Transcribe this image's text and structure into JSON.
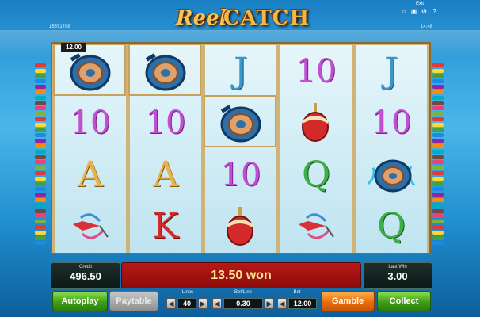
{
  "header": {
    "logo_word1": "Reel",
    "logo_word2": "CATCH",
    "session_id": "15571786",
    "exit_label": "Exit",
    "clock": "14:48"
  },
  "header_icons": [
    "music-icon",
    "fullscreen-icon",
    "settings-icon",
    "help-icon"
  ],
  "reels": [
    [
      "reel-symbol",
      "10",
      "A",
      "lure-symbol"
    ],
    [
      "reel-symbol",
      "10",
      "A",
      "K"
    ],
    [
      "J",
      "reel-symbol",
      "10",
      "bobber-symbol"
    ],
    [
      "10",
      "bobber-symbol",
      "Q",
      "lure-symbol"
    ],
    [
      "J",
      "10",
      "reel-scatter-symbol",
      "Q"
    ]
  ],
  "win_value_badge": "12.00",
  "panels": {
    "credit_label": "Credit",
    "credit_value": "496.50",
    "last_win_label": "Last Win",
    "last_win_value": "3.00"
  },
  "message": "13.50 won",
  "controls": {
    "autoplay_label": "Autoplay",
    "paytable_label": "Paytable",
    "lines_label": "Lines",
    "lines_value": "40",
    "bet_line_label": "Bet/Line",
    "bet_line_value": "0.30",
    "bet_label": "Bet",
    "bet_value": "12.00",
    "gamble_label": "Gamble",
    "collect_label": "Collect"
  },
  "colors": {
    "win_message_bg": "#b71818",
    "collect_green": "#3f9e17",
    "gamble_orange": "#ea6d0a"
  }
}
